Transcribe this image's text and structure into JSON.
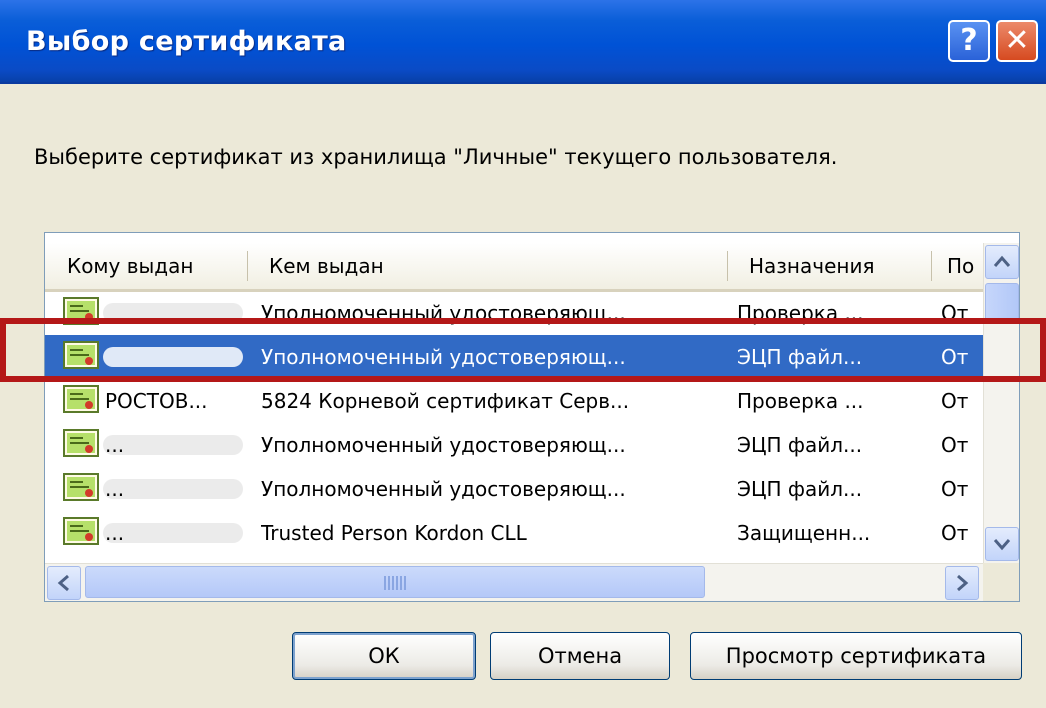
{
  "window": {
    "title": "Выбор сертификата",
    "help_button": "?",
    "close_button": "✕"
  },
  "message": "Выберите сертификат из хранилища \"Личные\" текущего пользователя.",
  "list": {
    "columns": [
      "Кому выдан",
      "Кем выдан",
      "Назначения",
      "По"
    ],
    "rows": [
      {
        "issued_to": "",
        "issued_by": "Уполномоченный удостоверяющ...",
        "purposes": "Проверка ...",
        "valid": "От"
      },
      {
        "issued_to": "",
        "issued_by": "Уполномоченный удостоверяющ...",
        "purposes": "ЭЦП файл...",
        "valid": "От",
        "selected": true
      },
      {
        "issued_to": "РОСТОВ...",
        "issued_by": "5824 Корневой сертификат Серв...",
        "purposes": "Проверка ...",
        "valid": "От"
      },
      {
        "issued_to": "...",
        "issued_by": "Уполномоченный удостоверяющ...",
        "purposes": "ЭЦП файл...",
        "valid": "От"
      },
      {
        "issued_to": "...",
        "issued_by": "Уполномоченный удостоверяющ...",
        "purposes": "ЭЦП файл...",
        "valid": "От"
      },
      {
        "issued_to": "...",
        "issued_by": "Trusted Person Kordon CLL",
        "purposes": "Защищенн...",
        "valid": "От"
      }
    ]
  },
  "buttons": {
    "ok": "ОК",
    "cancel": "Отмена",
    "view": "Просмотр сертификата"
  },
  "colors": {
    "title_bar": "#0a5ed8",
    "selection": "#316ac5",
    "highlight_box": "#b41818",
    "dialog_bg": "#ece9d8"
  }
}
